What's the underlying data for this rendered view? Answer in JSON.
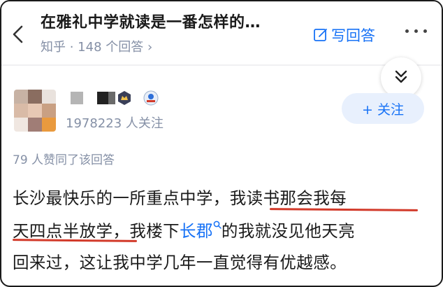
{
  "header": {
    "question_title": "在雅礼中学就读是一番怎样的…",
    "meta": "知乎 · 148 个回答",
    "meta_chevron": "›",
    "write_answer": "写回答",
    "back_icon": "chevron-left-icon",
    "more_icon": "more-dots-icon",
    "write_icon": "edit-icon"
  },
  "expand_icon": "double-chevron-down-icon",
  "author": {
    "followers": "1978223 人关注",
    "follow_button": "+ 关注"
  },
  "likes": "79 人赞同了该回答",
  "answer": {
    "line1_a": "长沙最快乐的一所重点中学，",
    "line1_b": "我读书那会我每",
    "line2_a": "天四点半放学，",
    "line2_b": "我楼下",
    "line2_link": "长郡",
    "line2_c": "的我就没见他天亮",
    "line3": "回来过，这让我中学几年一直觉得有优越感。"
  },
  "colors": {
    "accent": "#1772f6",
    "muted": "#8590a6",
    "underline": "#d23a2a",
    "text": "#1a1a1a"
  }
}
